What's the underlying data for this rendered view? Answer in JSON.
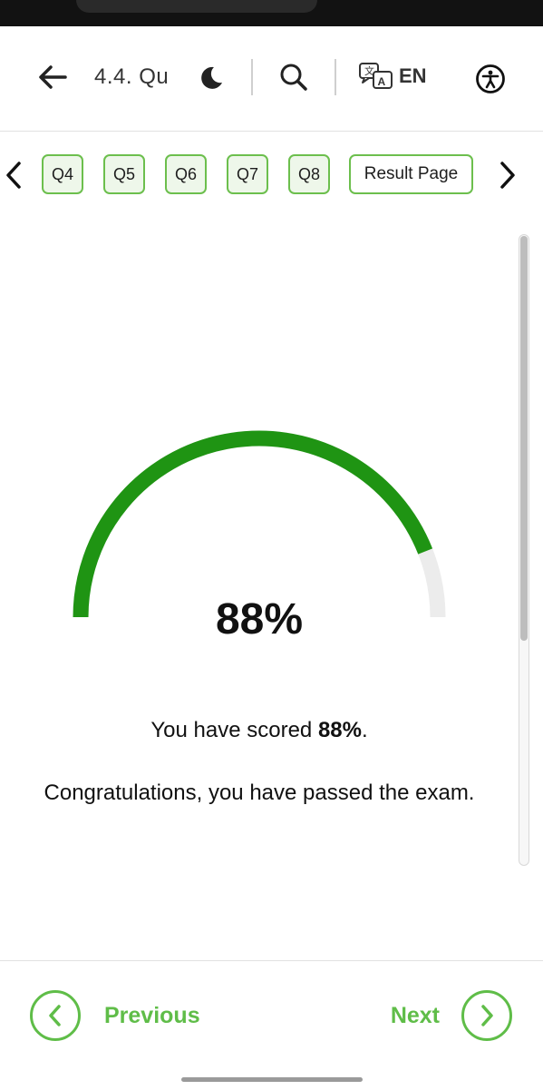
{
  "header": {
    "title": "4.4. Qu",
    "language": "EN",
    "icons": [
      "back-arrow-icon",
      "moon-icon",
      "search-icon",
      "translate-icon",
      "accessibility-icon"
    ]
  },
  "question_nav": {
    "items": [
      "Q4",
      "Q5",
      "Q6",
      "Q7",
      "Q8"
    ],
    "result_label": "Result Page"
  },
  "result": {
    "score_value": 88,
    "score_display": "88%",
    "scored_prefix": "You have scored ",
    "scored_value": "88%",
    "scored_suffix": ".",
    "message": "Congratulations, you have passed the exam."
  },
  "footer": {
    "previous_label": "Previous",
    "next_label": "Next"
  },
  "colors": {
    "gauge_fill": "#1f9413",
    "gauge_track": "#ececec",
    "accent_green": "#5fbd48",
    "chip_border": "#6cbf4d",
    "chip_bg": "#eef7ea"
  }
}
